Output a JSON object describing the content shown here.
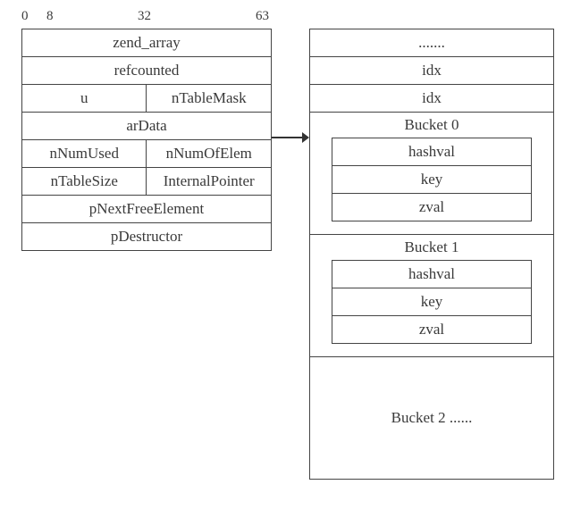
{
  "ticks": {
    "t0": "0",
    "t8": "8",
    "t32": "32",
    "t63": "63"
  },
  "left": {
    "r0": "zend_array",
    "r1": "refcounted",
    "r2a": "u",
    "r2b": "nTableMask",
    "r3": "arData",
    "r4a": "nNumUsed",
    "r4b": "nNumOfElem",
    "r5a": "nTableSize",
    "r5b": "InternalPointer",
    "r6": "pNextFreeElement",
    "r7": "pDestructor"
  },
  "right": {
    "dots": ".......",
    "idx1": "idx",
    "idx2": "idx",
    "bucket0": "Bucket 0",
    "bucket1": "Bucket 1",
    "bucket2": "Bucket 2 ......",
    "hashval": "hashval",
    "key": "key",
    "zval": "zval"
  }
}
